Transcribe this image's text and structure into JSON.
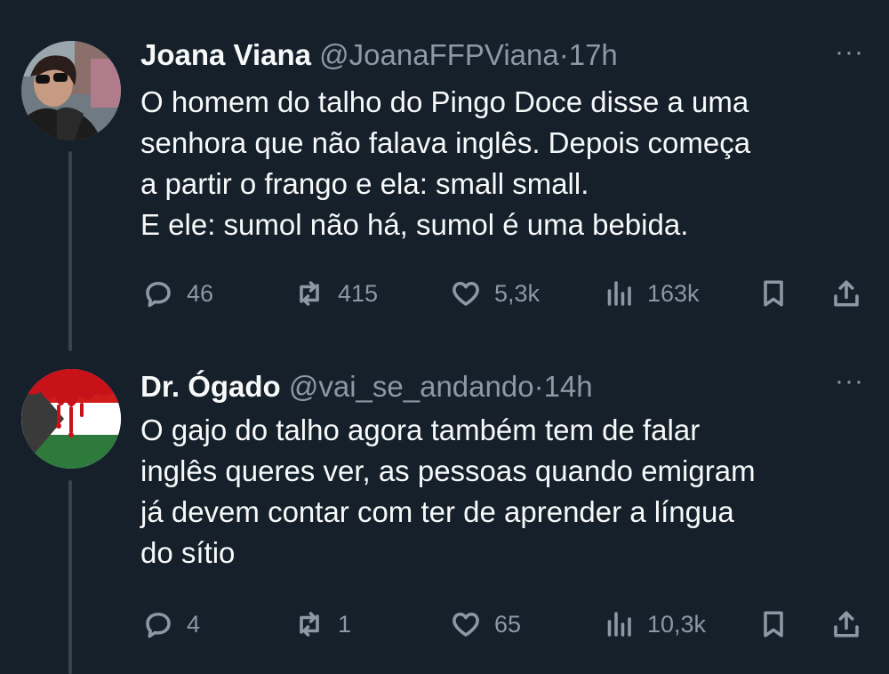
{
  "tweets": [
    {
      "name": "Joana Viana",
      "handle": "@JoanaFFPViana",
      "separator": "·",
      "time": "17h",
      "more": "···",
      "lines": [
        "O homem do talho do Pingo Doce disse a uma",
        "senhora que não falava inglês. Depois começa",
        "a partir o frango e ela: small small.",
        "E ele: sumol não há, sumol é uma bebida."
      ],
      "replies": "46",
      "retweets": "415",
      "likes": "5,3k",
      "views": "163k"
    },
    {
      "name": "Dr. Ógado",
      "handle": "@vai_se_andando",
      "separator": "·",
      "time": "14h",
      "more": "···",
      "lines": [
        "O gajo do talho agora também tem de falar",
        "inglês queres ver, as pessoas quando emigram",
        "já devem contar com ter de aprender a língua",
        "do sítio"
      ],
      "replies": "4",
      "retweets": "1",
      "likes": "65",
      "views": "10,3k"
    }
  ],
  "icons": {
    "reply": "reply-icon",
    "retweet": "retweet-icon",
    "like": "heart-icon",
    "views": "views-icon",
    "bookmark": "bookmark-icon",
    "share": "share-icon"
  },
  "colors": {
    "background": "#15202b",
    "text": "#f7f9f9",
    "secondary": "#8b98a5",
    "thread_line": "#38444d"
  }
}
